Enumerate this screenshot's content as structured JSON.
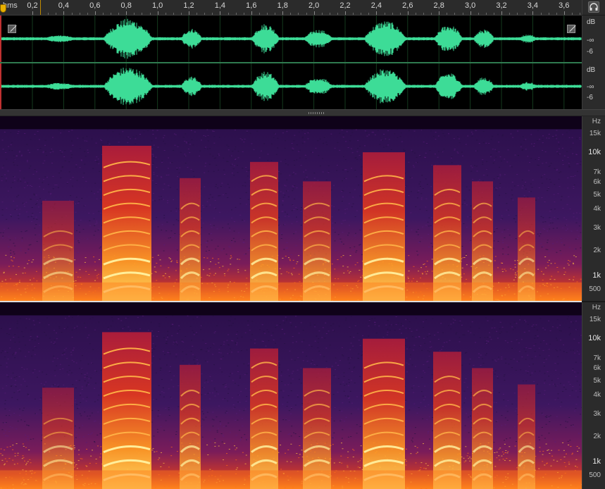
{
  "ruler": {
    "unit": "hms",
    "ticks": [
      "0,2",
      "0,4",
      "0,6",
      "0,8",
      "1,0",
      "1,2",
      "1,4",
      "1,6",
      "1,8",
      "2,0",
      "2,2",
      "2,4",
      "2,6",
      "2,8",
      "3,0",
      "3,2",
      "3,4",
      "3,6"
    ]
  },
  "corner_button": {
    "icon": "headphones-icon"
  },
  "waveform": {
    "color": "#3ddc97",
    "scale_top": [
      "dB",
      "-∞",
      "-6"
    ],
    "scale_bottom": [
      "dB",
      "-∞",
      "-6"
    ]
  },
  "spectrogram": {
    "scale_top": [
      "Hz",
      "15k",
      "10k",
      "7k",
      "6k",
      "5k",
      "4k",
      "3k",
      "2k",
      "1k",
      "500"
    ],
    "scale_bottom": [
      "Hz",
      "15k",
      "10k",
      "7k",
      "6k",
      "5k",
      "4k",
      "3k",
      "2k",
      "1k",
      "500"
    ]
  },
  "colors": {
    "wave_bg": "#000000",
    "spec_low": "#3a1560",
    "spec_mid": "#c4202a",
    "spec_high": "#ffe36b"
  }
}
